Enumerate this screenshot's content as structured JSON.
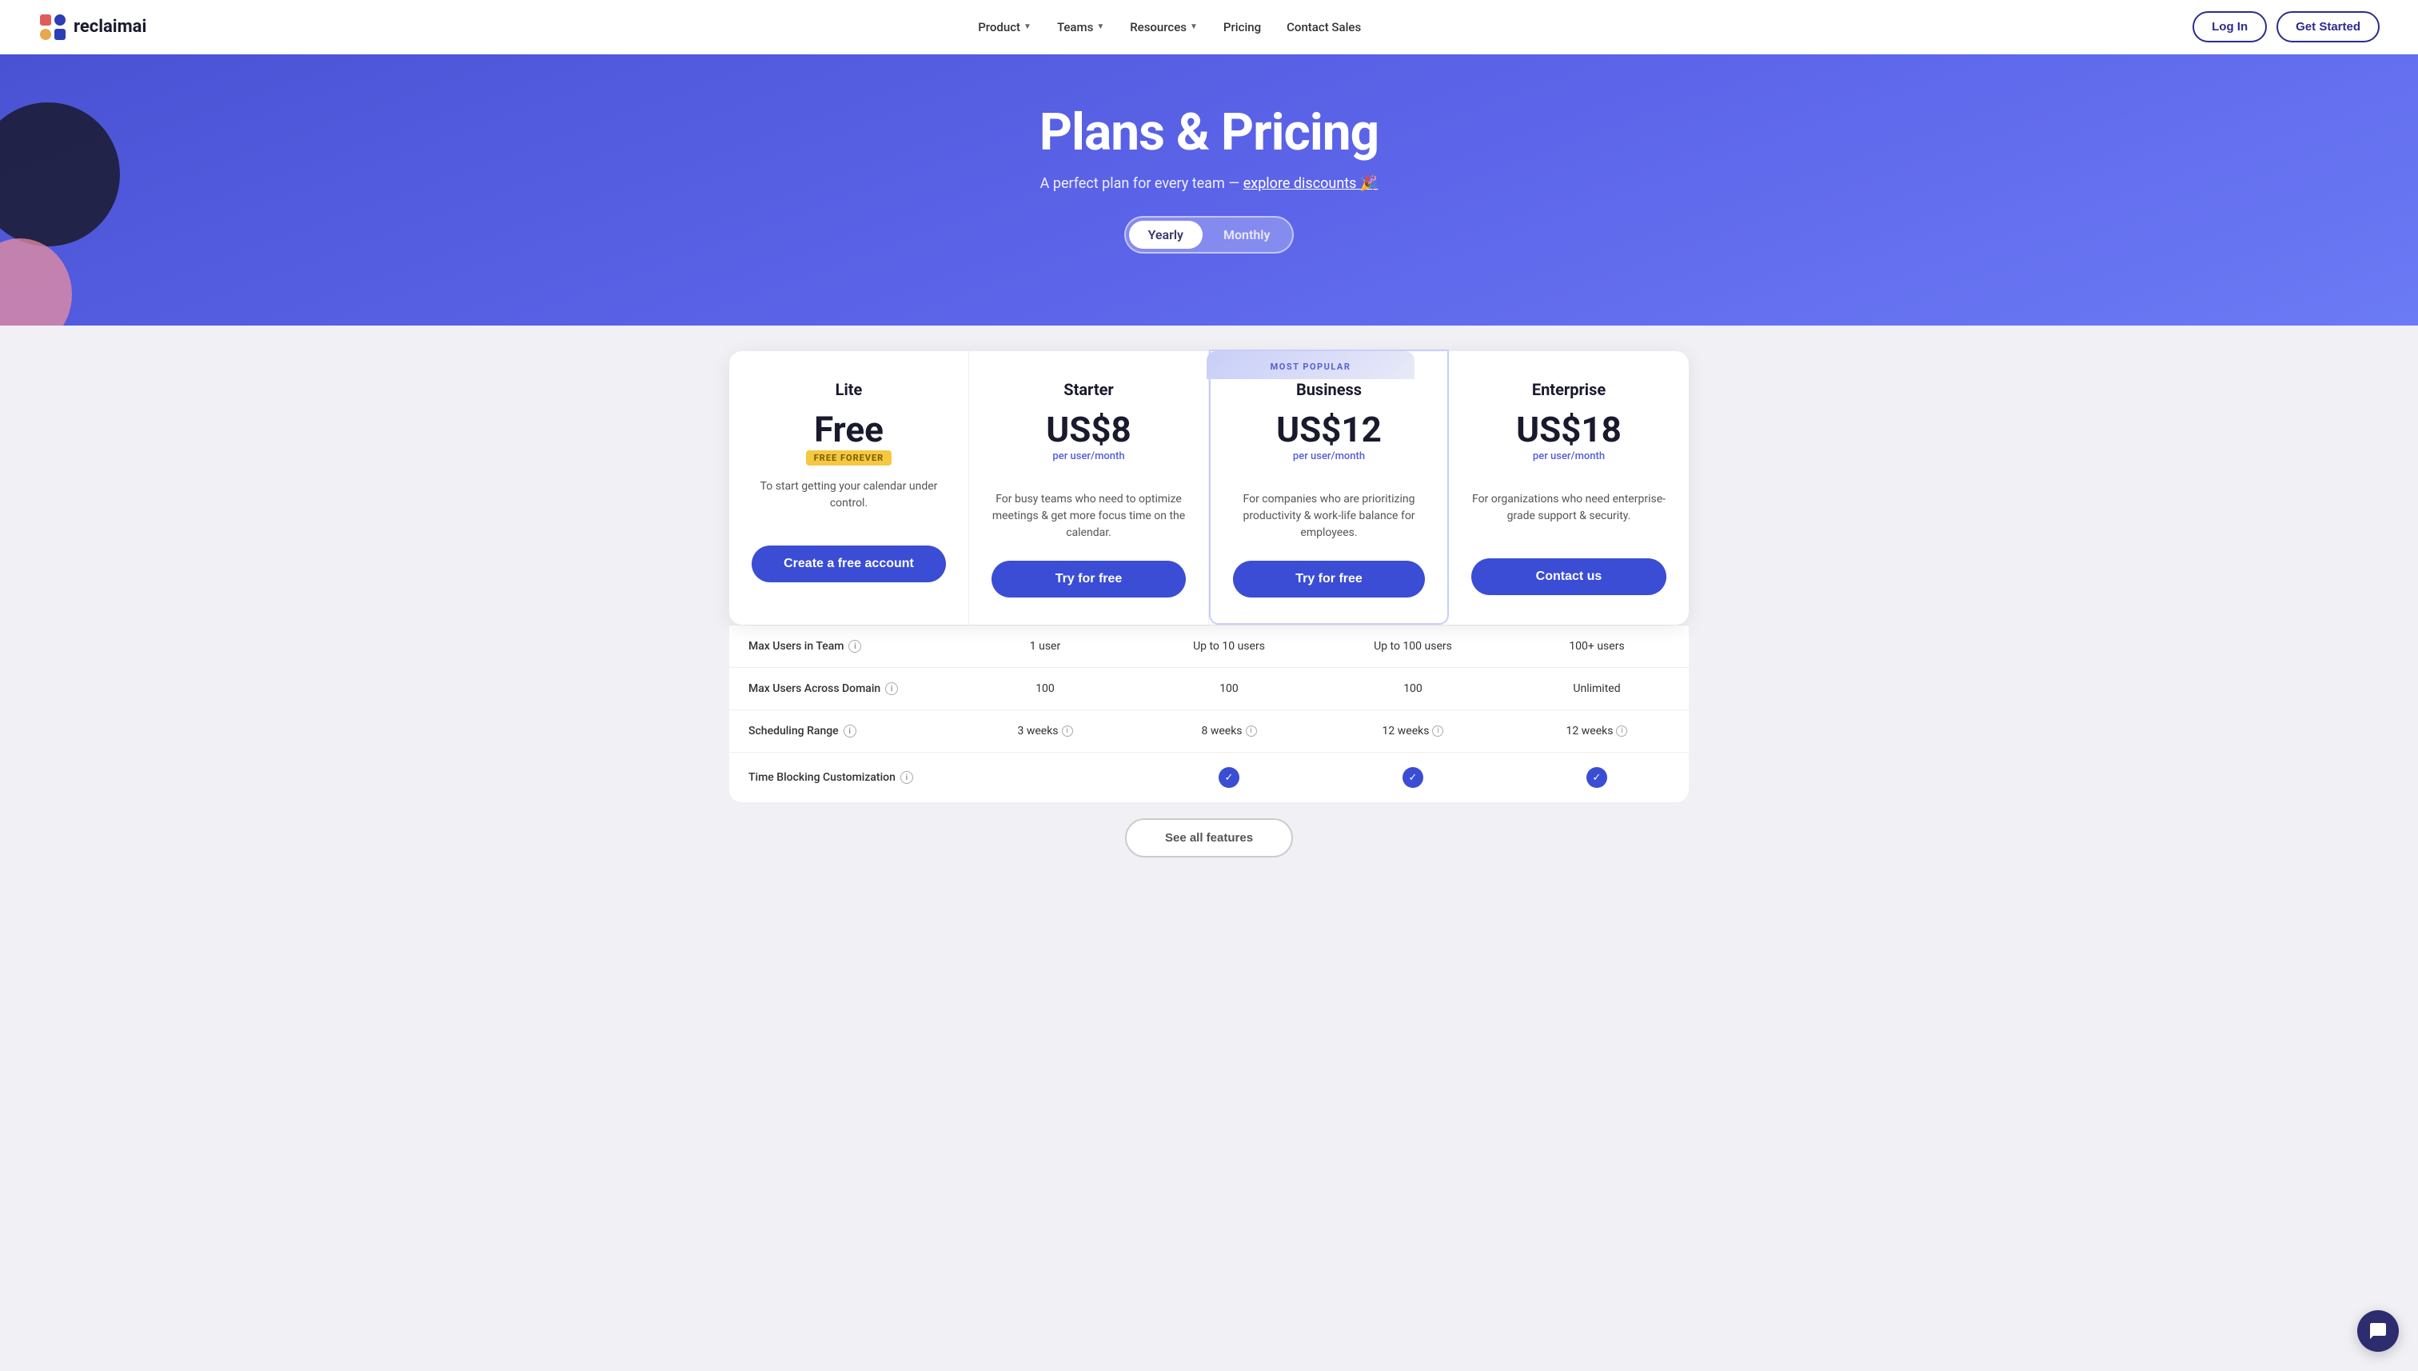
{
  "nav": {
    "logo_text": "reclaimai",
    "links": [
      {
        "label": "Product",
        "has_dropdown": true
      },
      {
        "label": "Teams",
        "has_dropdown": true
      },
      {
        "label": "Resources",
        "has_dropdown": true
      },
      {
        "label": "Pricing",
        "has_dropdown": false
      },
      {
        "label": "Contact Sales",
        "has_dropdown": false
      }
    ],
    "login_label": "Log In",
    "get_started_label": "Get Started"
  },
  "hero": {
    "title": "Plans & Pricing",
    "subtitle_text": "A perfect plan for every team — ",
    "subtitle_link": "explore discounts 🎉",
    "toggle": {
      "yearly_label": "Yearly",
      "monthly_label": "Monthly",
      "active": "yearly"
    }
  },
  "plans": [
    {
      "name": "Lite",
      "price": "Free",
      "price_unit": null,
      "badge": "FREE FOREVER",
      "description": "To start getting your calendar under control.",
      "cta_label": "Create a free account",
      "highlighted": false
    },
    {
      "name": "Starter",
      "price": "US$8",
      "price_unit": "per user/month",
      "badge": null,
      "description": "For busy teams who need to optimize meetings & get more focus time on the calendar.",
      "cta_label": "Try for free",
      "highlighted": false
    },
    {
      "name": "Business",
      "price": "US$12",
      "price_unit": "per user/month",
      "badge": null,
      "description": "For companies who are prioritizing productivity & work-life balance for employees.",
      "cta_label": "Try for free",
      "highlighted": true,
      "most_popular": true
    },
    {
      "name": "Enterprise",
      "price": "US$18",
      "price_unit": "per user/month",
      "badge": null,
      "description": "For organizations who need enterprise-grade support & security.",
      "cta_label": "Contact us",
      "highlighted": false
    }
  ],
  "features": [
    {
      "label": "Max Users in Team",
      "has_info": true,
      "values": [
        {
          "text": "1 user",
          "has_info": false,
          "check": false
        },
        {
          "text": "Up to 10 users",
          "has_info": false,
          "check": false
        },
        {
          "text": "Up to 100 users",
          "has_info": false,
          "check": false
        },
        {
          "text": "100+ users",
          "has_info": false,
          "check": false
        }
      ]
    },
    {
      "label": "Max Users Across Domain",
      "has_info": true,
      "values": [
        {
          "text": "100",
          "has_info": false,
          "check": false
        },
        {
          "text": "100",
          "has_info": false,
          "check": false
        },
        {
          "text": "100",
          "has_info": false,
          "check": false
        },
        {
          "text": "Unlimited",
          "has_info": false,
          "check": false
        }
      ]
    },
    {
      "label": "Scheduling Range",
      "has_info": true,
      "values": [
        {
          "text": "3 weeks",
          "has_info": true,
          "check": false
        },
        {
          "text": "8 weeks",
          "has_info": true,
          "check": false
        },
        {
          "text": "12 weeks",
          "has_info": true,
          "check": false
        },
        {
          "text": "12 weeks",
          "has_info": true,
          "check": false
        }
      ]
    },
    {
      "label": "Time Blocking Customization",
      "has_info": true,
      "values": [
        {
          "text": "",
          "has_info": false,
          "check": false
        },
        {
          "text": "",
          "has_info": false,
          "check": true
        },
        {
          "text": "",
          "has_info": false,
          "check": true
        },
        {
          "text": "",
          "has_info": false,
          "check": true
        }
      ]
    }
  ],
  "see_all_features_label": "See all features"
}
